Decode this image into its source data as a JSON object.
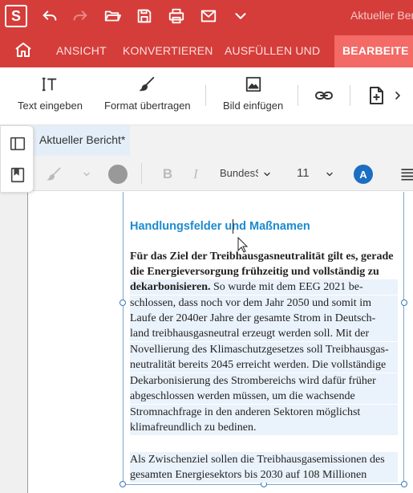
{
  "app": {
    "logo_letter": "S",
    "document_title": "Aktueller Ber"
  },
  "ribbon": {
    "tabs": [
      "ANSICHT",
      "KONVERTIEREN",
      "AUSFÜLLEN UND",
      "BEARBEITE"
    ],
    "active_tab": "BEARBEITE"
  },
  "toolbar": {
    "text_label": "Text eingeben",
    "format_label": "Format übertragen",
    "image_label": "Bild einfügen"
  },
  "document_tab": "Aktueller Bericht*",
  "format": {
    "font_name": "BundesS",
    "font_size": "11",
    "bold": "B",
    "italic": "I",
    "text_color_letter": "A",
    "accent_color": "#1b6ec2"
  },
  "content": {
    "heading": "Handlungsfelder und Maßnamen",
    "p1_bold_1": "Für das Ziel der Treibhausgasneutralität gilt es, gerade",
    "p1_bold_2": "die Energieversorgung frühzeitig und vollständig zu",
    "p1_bold_3": "dekarbonisieren.",
    "p1_line3_rest": " So wurde mit dem EEG 2021 be-",
    "p1_lines": [
      "schlossen, dass noch vor dem Jahr 2050 und somit im",
      "Laufe der 2040er Jahre der gesamte Strom in Deutsch-",
      "land treibhausgasneutral erzeugt werden soll. Mit der",
      "Novellierung des Klimaschutzgesetzes soll Treibhausgas-",
      "neutralität bereits 2045 erreicht werden. Die vollständige",
      "Dekarbonisierung des Strombereichs wird dafür früher",
      "abgeschlossen werden müssen, um die wachsende",
      "Stromnachfrage in den anderen Sektoren möglichst",
      "klimafreundlich zu bedinen."
    ],
    "p2_lines": [
      "Als Zwischenziel sollen die Treibhausgasemissionen des",
      "gesamten Energiesektors bis 2030 auf 108 Millionen"
    ]
  },
  "colors": {
    "brand_red": "#d53d3a",
    "active_tab": "#f36a66",
    "heading_blue": "#1b8bcf"
  }
}
